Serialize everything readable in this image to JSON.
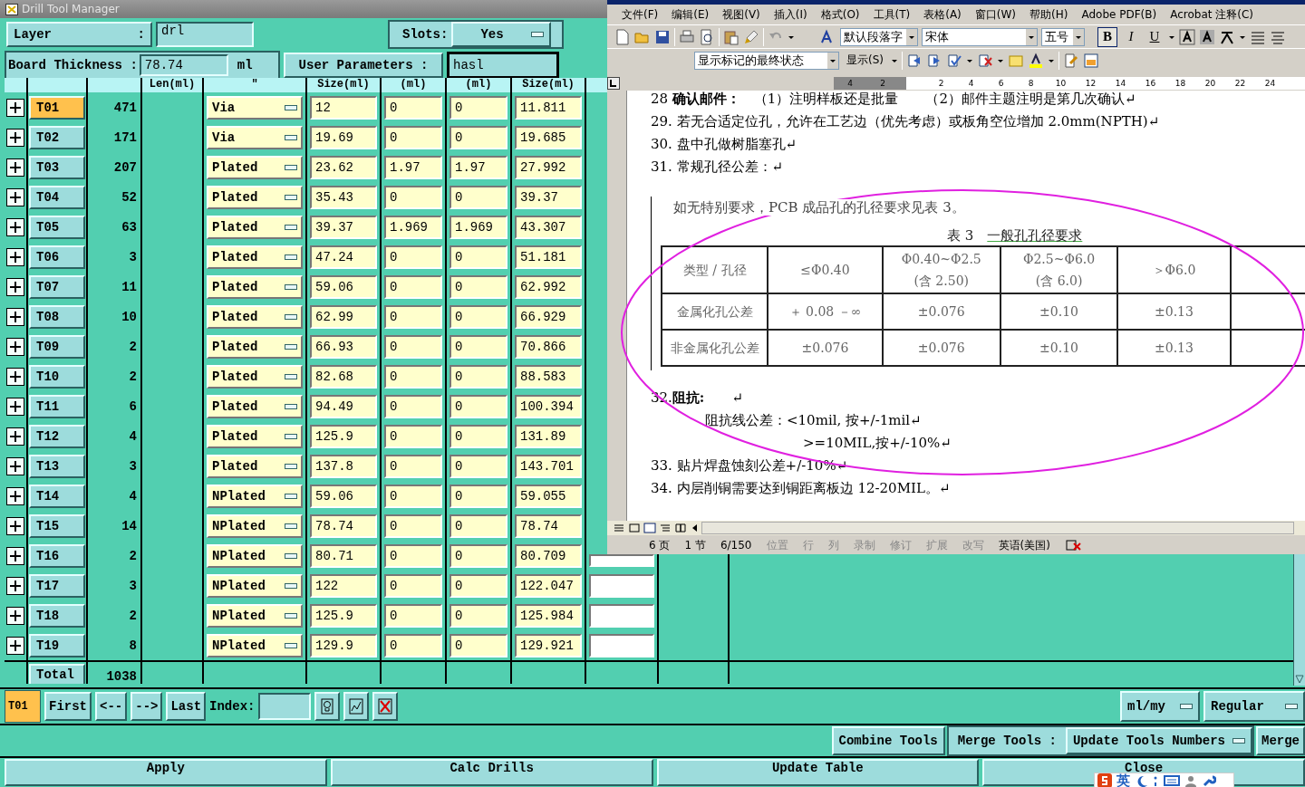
{
  "drill_manager": {
    "title": "Drill Tool Manager",
    "layer": {
      "label": "Layer",
      "separator": ":",
      "value": "drl"
    },
    "slots": {
      "label": "Slots:",
      "value": "Yes"
    },
    "board_thickness": {
      "label": "Board Thickness :",
      "value": "78.74",
      "unit": "ml"
    },
    "user_parameters": {
      "label": "User Parameters :",
      "value": "hasl"
    },
    "columns": [
      "",
      "",
      "",
      "Len(ml)",
      "\"",
      "Size(ml)",
      "(ml)",
      "(ml)",
      "Size(ml)"
    ],
    "rows": [
      {
        "tool": "T01",
        "selected": true,
        "count": "471",
        "type": "Via",
        "size": "12",
        "col_7": "0",
        "col_8": "0",
        "finish": "11.811"
      },
      {
        "tool": "T02",
        "selected": false,
        "count": "171",
        "type": "Via",
        "size": "19.69",
        "col_7": "0",
        "col_8": "0",
        "finish": "19.685"
      },
      {
        "tool": "T03",
        "selected": false,
        "count": "207",
        "type": "Plated",
        "size": "23.62",
        "col_7": "1.97",
        "col_8": "1.97",
        "finish": "27.992"
      },
      {
        "tool": "T04",
        "selected": false,
        "count": "52",
        "type": "Plated",
        "size": "35.43",
        "col_7": "0",
        "col_8": "0",
        "finish": "39.37"
      },
      {
        "tool": "T05",
        "selected": false,
        "count": "63",
        "type": "Plated",
        "size": "39.37",
        "col_7": "1.969",
        "col_8": "1.969",
        "finish": "43.307"
      },
      {
        "tool": "T06",
        "selected": false,
        "count": "3",
        "type": "Plated",
        "size": "47.24",
        "col_7": "0",
        "col_8": "0",
        "finish": "51.181"
      },
      {
        "tool": "T07",
        "selected": false,
        "count": "11",
        "type": "Plated",
        "size": "59.06",
        "col_7": "0",
        "col_8": "0",
        "finish": "62.992"
      },
      {
        "tool": "T08",
        "selected": false,
        "count": "10",
        "type": "Plated",
        "size": "62.99",
        "col_7": "0",
        "col_8": "0",
        "finish": "66.929"
      },
      {
        "tool": "T09",
        "selected": false,
        "count": "2",
        "type": "Plated",
        "size": "66.93",
        "col_7": "0",
        "col_8": "0",
        "finish": "70.866"
      },
      {
        "tool": "T10",
        "selected": false,
        "count": "2",
        "type": "Plated",
        "size": "82.68",
        "col_7": "0",
        "col_8": "0",
        "finish": "88.583"
      },
      {
        "tool": "T11",
        "selected": false,
        "count": "6",
        "type": "Plated",
        "size": "94.49",
        "col_7": "0",
        "col_8": "0",
        "finish": "100.394"
      },
      {
        "tool": "T12",
        "selected": false,
        "count": "4",
        "type": "Plated",
        "size": "125.9",
        "col_7": "0",
        "col_8": "0",
        "finish": "131.89"
      },
      {
        "tool": "T13",
        "selected": false,
        "count": "3",
        "type": "Plated",
        "size": "137.8",
        "col_7": "0",
        "col_8": "0",
        "finish": "143.701"
      },
      {
        "tool": "T14",
        "selected": false,
        "count": "4",
        "type": "NPlated",
        "size": "59.06",
        "col_7": "0",
        "col_8": "0",
        "finish": "59.055"
      },
      {
        "tool": "T15",
        "selected": false,
        "count": "14",
        "type": "NPlated",
        "size": "78.74",
        "col_7": "0",
        "col_8": "0",
        "finish": "78.74"
      },
      {
        "tool": "T16",
        "selected": false,
        "count": "2",
        "type": "NPlated",
        "size": "80.71",
        "col_7": "0",
        "col_8": "0",
        "finish": "80.709"
      },
      {
        "tool": "T17",
        "selected": false,
        "count": "3",
        "type": "NPlated",
        "size": "122",
        "col_7": "0",
        "col_8": "0",
        "finish": "122.047"
      },
      {
        "tool": "T18",
        "selected": false,
        "count": "2",
        "type": "NPlated",
        "size": "125.9",
        "col_7": "0",
        "col_8": "0",
        "finish": "125.984"
      },
      {
        "tool": "T19",
        "selected": false,
        "count": "8",
        "type": "NPlated",
        "size": "129.9",
        "col_7": "0",
        "col_8": "0",
        "finish": "129.921"
      }
    ],
    "total": {
      "label": "Total",
      "count": "1038"
    },
    "current_tool": "T01",
    "nav_buttons": [
      "First",
      "<--",
      "-->",
      "Last"
    ],
    "index_label": "Index:",
    "units": "ml/my",
    "mode": "Regular",
    "combine": "Combine Tools",
    "merge_label": "Merge Tools :",
    "merge_mode": "Update Tools Numbers",
    "merge": "Merge",
    "actions": [
      "Apply",
      "Calc Drills",
      "Update Table",
      "Close"
    ]
  },
  "word": {
    "menu": [
      "文件(F)",
      "编辑(E)",
      "视图(V)",
      "插入(I)",
      "格式(O)",
      "工具(T)",
      "表格(A)",
      "窗口(W)",
      "帮助(H)",
      "Adobe PDF(B)",
      "Acrobat 注释(C)"
    ],
    "style": "默认段落字",
    "font": "宋体",
    "size": "五号",
    "format_buttons": [
      {
        "label": "B",
        "selected": true
      },
      {
        "label": "I",
        "selected": false
      },
      {
        "label": "U",
        "selected": false
      }
    ],
    "markup_view": "显示标记的最终状态",
    "show_menu": "显示(S)",
    "ruler": [
      "4",
      "2",
      "2",
      "4",
      "6",
      "8",
      "10",
      "12",
      "14",
      "16",
      "18",
      "20",
      "22",
      "24"
    ],
    "lines": [
      {
        "kind": "item",
        "text": "28 **确认邮件：**　（1）注明样板还是批量　　（2）邮件主题注明是第几次确认↵"
      },
      {
        "kind": "item",
        "text": "29. 若无合适定位孔，允许在工艺边（优先考虑）或板角空位增加 2.0mm(NPTH)↵"
      },
      {
        "kind": "item",
        "text": "30. 盘中孔做树脂塞孔↵"
      },
      {
        "kind": "item",
        "text": "31. 常规孔径公差：↵"
      }
    ],
    "note": "如无特别要求，PCB 成品孔的孔径要求见表 3。",
    "caption": {
      "number": "表 3",
      "title": "一般孔孔径要求"
    },
    "table": {
      "header": [
        [
          "类型 / 孔径"
        ],
        [
          "≤Φ0.40"
        ],
        [
          "Φ0.40~Φ2.5",
          "(含 2.50)"
        ],
        [
          "Φ2.5~Φ6.0",
          "(含 6.0)"
        ],
        [
          "＞Φ6.0"
        ]
      ],
      "rows": [
        [
          "金属化孔公差",
          "＋ 0.08 －∞",
          "±0.076",
          "±0.10",
          "±0.13"
        ],
        [
          "非金属化孔公差",
          "±0.076",
          "±0.076",
          "±0.10",
          "±0.13"
        ]
      ]
    },
    "after_lines": [
      {
        "kind": "item",
        "text": "32.**阻抗:**　　↵"
      },
      {
        "kind": "sub",
        "text": "阻抗线公差：<10mil, 按+/-1mil↵"
      },
      {
        "kind": "subsub",
        "text": ">=10MIL,按+/-10%↵"
      },
      {
        "kind": "item",
        "text": "33. 贴片焊盘蚀刻公差+/-10%↵"
      },
      {
        "kind": "item",
        "text": "34. 内层削铜需要达到铜距离板边 12-20MIL。↵"
      }
    ],
    "status": [
      {
        "text": "6 页",
        "disabled": false
      },
      {
        "text": "1 节",
        "disabled": false
      },
      {
        "text": "6/150",
        "disabled": false
      },
      {
        "text": "位置",
        "disabled": true
      },
      {
        "text": "行",
        "disabled": true
      },
      {
        "text": "列",
        "disabled": true
      },
      {
        "text": "录制",
        "disabled": true
      },
      {
        "text": "修订",
        "disabled": true
      },
      {
        "text": "扩展",
        "disabled": true
      },
      {
        "text": "改写",
        "disabled": true
      },
      {
        "text": "英语(美国)",
        "disabled": false
      }
    ]
  },
  "ime": {
    "mode": "英"
  }
}
